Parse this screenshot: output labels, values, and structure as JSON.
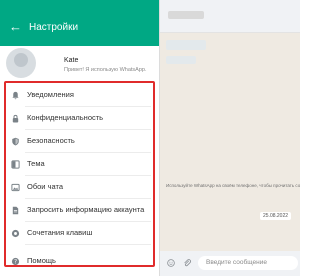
{
  "header": {
    "title": "Настройки",
    "back_glyph": "←"
  },
  "profile": {
    "name": "Kate",
    "status": "Привет! Я использую WhatsApp."
  },
  "menu": [
    {
      "label": "Уведомления",
      "icon": "bell-icon"
    },
    {
      "label": "Конфиденциальность",
      "icon": "lock-icon"
    },
    {
      "label": "Безопасность",
      "icon": "shield-icon"
    },
    {
      "label": "Тема",
      "icon": "theme-icon"
    },
    {
      "label": "Обои чата",
      "icon": "wallpaper-icon"
    },
    {
      "label": "Запросить информацию аккаунта",
      "icon": "document-icon"
    },
    {
      "label": "Сочетания клавиш",
      "icon": "keyboard-icon"
    },
    {
      "label": "Помощь",
      "icon": "help-icon"
    }
  ],
  "chat": {
    "system_note": "Используйте WhatsApp на своём телефоне, чтобы прочитать сообщения от 26.08.2022",
    "date_chip": "25.08.2022",
    "input_placeholder": "Введите сообщение"
  },
  "colors": {
    "header": "#00a884",
    "highlight": "#e02b2b",
    "icon": "#7a8288"
  }
}
